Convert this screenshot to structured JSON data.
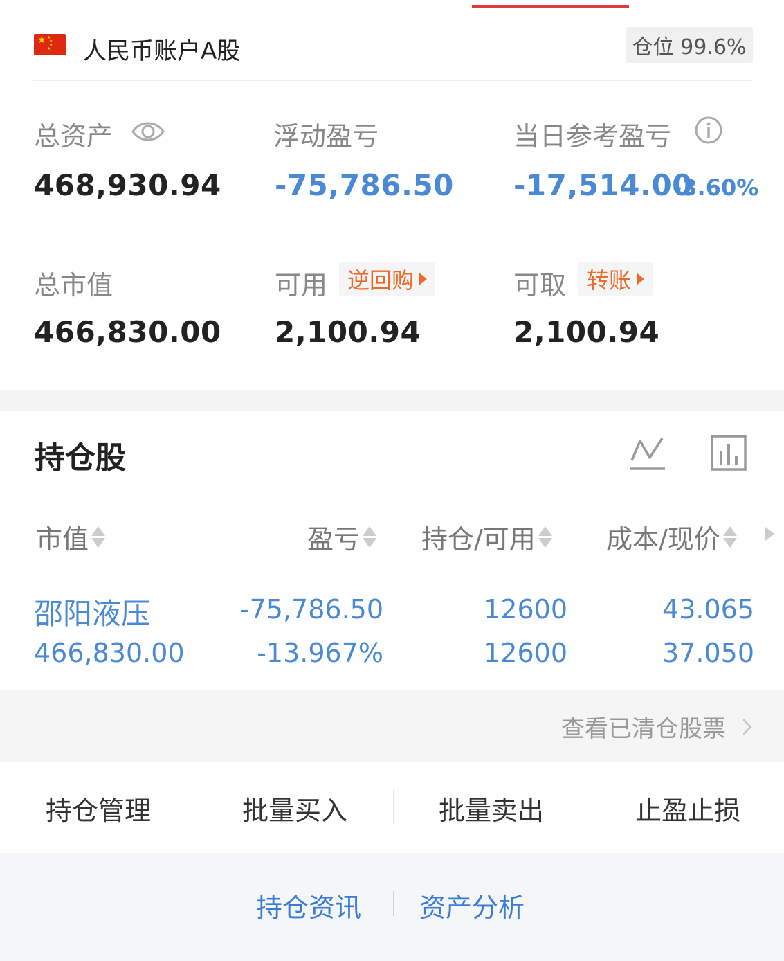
{
  "account": {
    "name": "人民币账户A股",
    "position_label": "仓位 99.6%"
  },
  "summary": {
    "total_assets_label": "总资产",
    "total_assets_value": "468,930.94",
    "floating_pl_label": "浮动盈亏",
    "floating_pl_value": "-75,786.50",
    "daily_pl_label": "当日参考盈亏",
    "daily_pl_value": "-17,514.00",
    "daily_pl_pct": "-3.60%",
    "market_value_label": "总市值",
    "market_value_value": "466,830.00",
    "available_label": "可用",
    "available_value": "2,100.94",
    "reverse_repo_tag": "逆回购",
    "withdrawable_label": "可取",
    "withdrawable_value": "2,100.94",
    "transfer_tag": "转账"
  },
  "holdings": {
    "title": "持仓股",
    "columns": [
      "市值",
      "盈亏",
      "持仓/可用",
      "成本/现价"
    ],
    "rows": [
      {
        "name": "邵阳液压",
        "market_value": "466,830.00",
        "pl": "-75,786.50",
        "pl_pct": "-13.967%",
        "position": "12600",
        "available": "12600",
        "cost": "43.065",
        "price": "37.050"
      }
    ],
    "cleared_link": "查看已清仓股票"
  },
  "actions": [
    "持仓管理",
    "批量买入",
    "批量卖出",
    "止盈止损"
  ],
  "bottom_links": [
    "持仓资讯",
    "资产分析"
  ],
  "colors": {
    "accent_red": "#e03a3a",
    "value_blue": "#4a8ad4",
    "tag_orange": "#ee6a2a",
    "link_blue": "#3a7bd5"
  },
  "icons": [
    "china-flag-icon",
    "eye-icon",
    "info-icon",
    "line-chart-icon",
    "bar-chart-icon",
    "sort-icon",
    "chevron-right-icon"
  ]
}
